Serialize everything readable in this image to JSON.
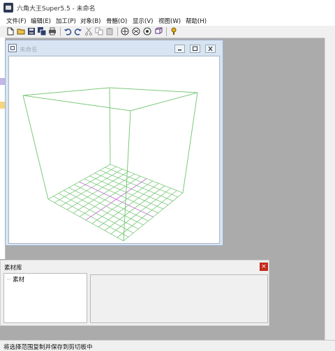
{
  "app": {
    "title": "六角大王Super5.5 - 未命名"
  },
  "menu": [
    {
      "label": "文件(F)"
    },
    {
      "label": "编辑(E)"
    },
    {
      "label": "加工(P)"
    },
    {
      "label": "对象(B)"
    },
    {
      "label": "骨骼(O)"
    },
    {
      "label": "显示(V)"
    },
    {
      "label": "视图(W)"
    },
    {
      "label": "帮助(H)"
    }
  ],
  "toolbar": {
    "icons": [
      "new-file-icon",
      "open-folder-icon",
      "save-icon",
      "save-as-icon",
      "print-icon",
      "undo-icon",
      "redo-icon",
      "cut-icon",
      "copy-icon",
      "paste-icon",
      "view-front-icon",
      "view-side-icon",
      "view-top-icon",
      "view-perspective-icon",
      "light-icon"
    ]
  },
  "document_window": {
    "title": "未命名"
  },
  "material_panel": {
    "title": "素材库",
    "tree_items": [
      {
        "label": "素材"
      }
    ]
  },
  "status": {
    "text": "将选择范围复制并保存到剪切板中"
  },
  "colors": {
    "wireframe": "#7cc97c",
    "axis_highlight": "#c46ad6",
    "close_button": "#c42b1c"
  }
}
